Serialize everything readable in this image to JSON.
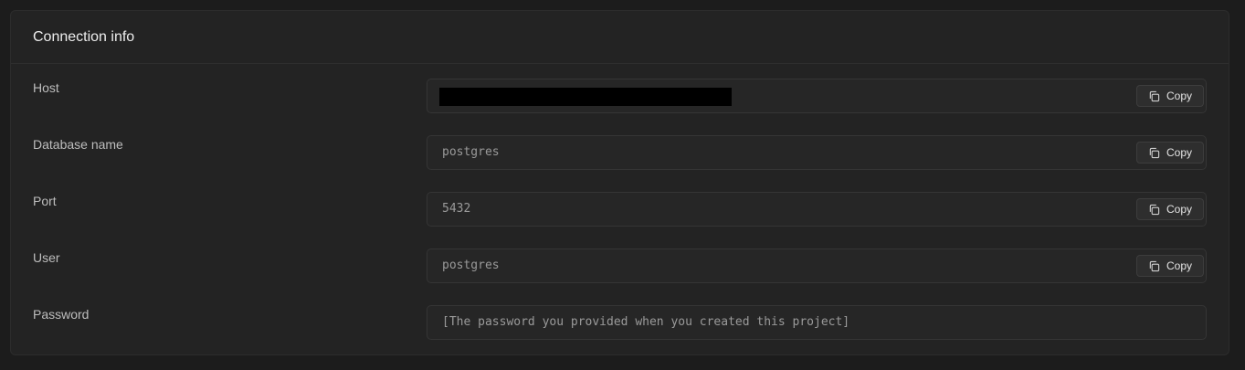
{
  "panel": {
    "title": "Connection info"
  },
  "fields": [
    {
      "label": "Host",
      "value": "",
      "redacted": true,
      "copy_label": "Copy"
    },
    {
      "label": "Database name",
      "value": "postgres",
      "copy_label": "Copy"
    },
    {
      "label": "Port",
      "value": "5432",
      "copy_label": "Copy"
    },
    {
      "label": "User",
      "value": "postgres",
      "copy_label": "Copy"
    },
    {
      "label": "Password",
      "value": "[The password you provided when you created this project]"
    }
  ],
  "icons": {
    "copy": "copy-icon"
  },
  "colors": {
    "background": "#1c1c1c",
    "panel": "#232323",
    "field": "#262626",
    "text_primary": "#ededed",
    "text_secondary": "#bdbdbd",
    "text_mono": "#9a9a9a"
  }
}
